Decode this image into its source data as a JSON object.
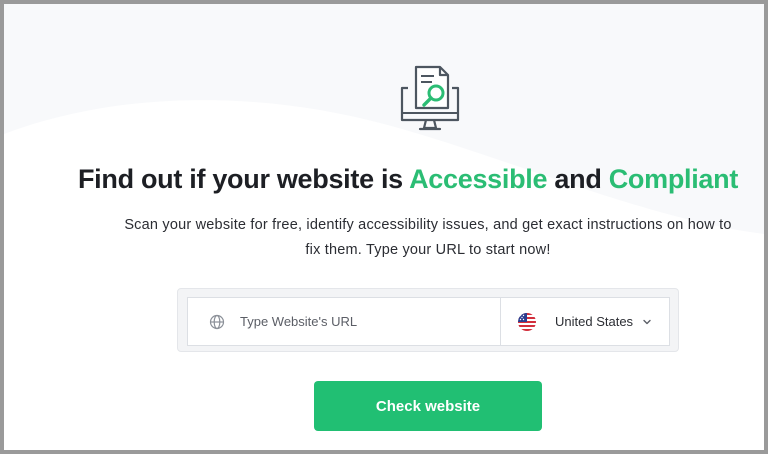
{
  "hero": {
    "icon": "monitor-document-search-icon",
    "headline_prefix": "Find out if your website is ",
    "headline_accent_1": "Accessible",
    "headline_middle": " and ",
    "headline_accent_2": "Compliant",
    "subtitle": "Scan your website for free, identify accessibility issues, and get exact instructions on how to fix them. Type your URL to start now!"
  },
  "form": {
    "url_icon": "globe-icon",
    "url_placeholder": "Type Website's URL",
    "url_value": "",
    "country_flag": "us-flag-icon",
    "country_label": "United States",
    "dropdown_icon": "chevron-down-icon"
  },
  "actions": {
    "check_label": "Check website"
  },
  "colors": {
    "accent": "#2bbd74",
    "button": "#21bf73",
    "heading": "#1d1f24",
    "frame": "#9a9a9a"
  }
}
